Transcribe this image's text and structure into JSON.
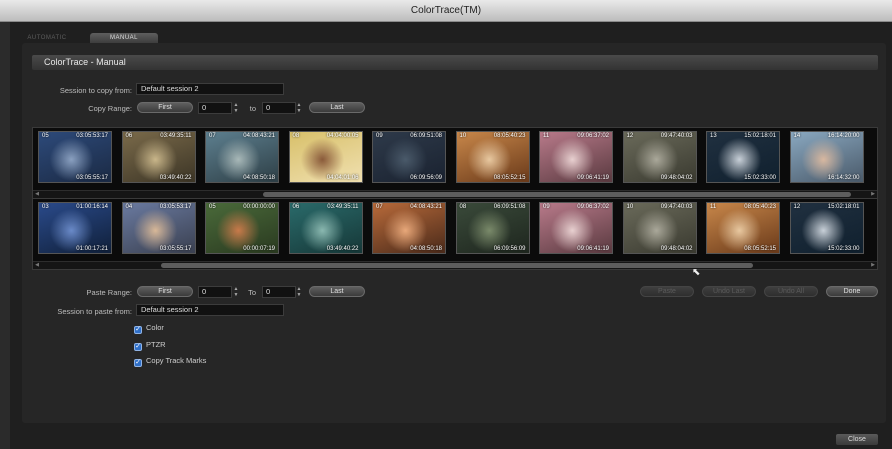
{
  "window": {
    "title": "ColorTrace(TM)"
  },
  "tabs": [
    {
      "label": "AUTOMATIC"
    },
    {
      "label": "MANUAL"
    }
  ],
  "header": {
    "title": "ColorTrace - Manual"
  },
  "copy": {
    "session_label": "Session to copy from:",
    "session_value": "Default session 2",
    "range_label": "Copy Range:",
    "first_label": "First",
    "from_value": "0",
    "to_label": "to",
    "to_value": "0",
    "last_label": "Last"
  },
  "source_strip": {
    "thumbs": [
      {
        "num": "05",
        "tc_in": "03:05:53:17",
        "tc_out": "03:05:55:17",
        "colors": [
          "#2d4a7a",
          "#8aa0c0",
          "#1b2a44"
        ]
      },
      {
        "num": "06",
        "tc_in": "03:49:35:11",
        "tc_out": "03:49:40:22",
        "colors": [
          "#7a6a4a",
          "#c9b68a",
          "#3c3526"
        ]
      },
      {
        "num": "07",
        "tc_in": "04:08:43:21",
        "tc_out": "04:08:50:18",
        "colors": [
          "#5d7f8f",
          "#a8b8b8",
          "#2e3f46"
        ]
      },
      {
        "num": "08",
        "tc_in": "04:04:00:05",
        "tc_out": "04:04:01:06",
        "colors": [
          "#d8c06a",
          "#8a5a3a",
          "#f0e0b0"
        ]
      },
      {
        "num": "09",
        "tc_in": "06:09:51:08",
        "tc_out": "06:09:56:09",
        "colors": [
          "#2e3a4a",
          "#4a5a6a",
          "#1a2230"
        ]
      },
      {
        "num": "10",
        "tc_in": "08:05:40:23",
        "tc_out": "08:05:52:15",
        "colors": [
          "#c8874a",
          "#e8c8a0",
          "#6a3a1a"
        ]
      },
      {
        "num": "11",
        "tc_in": "09:06:37:02",
        "tc_out": "09:06:41:19",
        "colors": [
          "#b87a8a",
          "#e8d0d0",
          "#5a3a40"
        ]
      },
      {
        "num": "12",
        "tc_in": "09:47:40:03",
        "tc_out": "09:48:04:02",
        "colors": [
          "#6a6a5a",
          "#aaa89a",
          "#3a3a30"
        ]
      },
      {
        "num": "13",
        "tc_in": "15:02:18:01",
        "tc_out": "15:02:33:00",
        "colors": [
          "#203040",
          "#c8d0d8",
          "#10202e"
        ]
      },
      {
        "num": "14",
        "tc_in": "16:14:20:00",
        "tc_out": "16:14:32:00",
        "colors": [
          "#8aa8c0",
          "#d8b8a0",
          "#4a5a6a"
        ]
      }
    ]
  },
  "target_strip": {
    "thumbs": [
      {
        "num": "03",
        "tc_in": "01:00:16:14",
        "tc_out": "01:00:17:21",
        "colors": [
          "#2a4a8a",
          "#6a8ac8",
          "#10203a"
        ]
      },
      {
        "num": "04",
        "tc_in": "03:05:53:17",
        "tc_out": "03:05:55:17",
        "colors": [
          "#6a7aa0",
          "#d8b898",
          "#3a4050"
        ]
      },
      {
        "num": "05",
        "tc_in": "00:00:00:00",
        "tc_out": "00:00:07:19",
        "colors": [
          "#4a6a3a",
          "#c87a4a",
          "#2a3a20"
        ]
      },
      {
        "num": "06",
        "tc_in": "03:49:35:11",
        "tc_out": "03:49:40:22",
        "colors": [
          "#2a6a6a",
          "#8ab8b0",
          "#163838"
        ]
      },
      {
        "num": "07",
        "tc_in": "04:08:43:21",
        "tc_out": "04:08:50:18",
        "colors": [
          "#b86a3a",
          "#e8a87a",
          "#4a2a1a"
        ]
      },
      {
        "num": "08",
        "tc_in": "06:09:51:08",
        "tc_out": "06:09:56:09",
        "colors": [
          "#3a4a3a",
          "#7a8a6a",
          "#1e261e"
        ]
      },
      {
        "num": "09",
        "tc_in": "09:06:37:02",
        "tc_out": "09:06:41:19",
        "colors": [
          "#b87a8a",
          "#e8d0d0",
          "#5a3a40"
        ]
      },
      {
        "num": "10",
        "tc_in": "09:47:40:03",
        "tc_out": "09:48:04:02",
        "colors": [
          "#6a6a5a",
          "#aaa89a",
          "#3a3a30"
        ]
      },
      {
        "num": "11",
        "tc_in": "08:05:40:23",
        "tc_out": "08:05:52:15",
        "colors": [
          "#c8874a",
          "#e8c8a0",
          "#6a3a1a"
        ]
      },
      {
        "num": "12",
        "tc_in": "15:02:18:01",
        "tc_out": "15:02:33:00",
        "colors": [
          "#203040",
          "#c8d0d8",
          "#10202e"
        ]
      }
    ]
  },
  "paste": {
    "range_label": "Paste Range:",
    "first_label": "First",
    "from_value": "0",
    "to_label": "To",
    "to_value": "0",
    "last_label": "Last",
    "session_label": "Session to paste from:",
    "session_value": "Default session 2"
  },
  "actions": [
    {
      "label": "Paste",
      "enabled": false
    },
    {
      "label": "Undo Last",
      "enabled": false
    },
    {
      "label": "Undo All",
      "enabled": false
    },
    {
      "label": "Done",
      "enabled": true
    }
  ],
  "options": [
    {
      "label": "Color",
      "checked": true
    },
    {
      "label": "PTZR",
      "checked": true
    },
    {
      "label": "Copy Track Marks",
      "checked": true
    }
  ],
  "footer": {
    "close_label": "Close"
  }
}
